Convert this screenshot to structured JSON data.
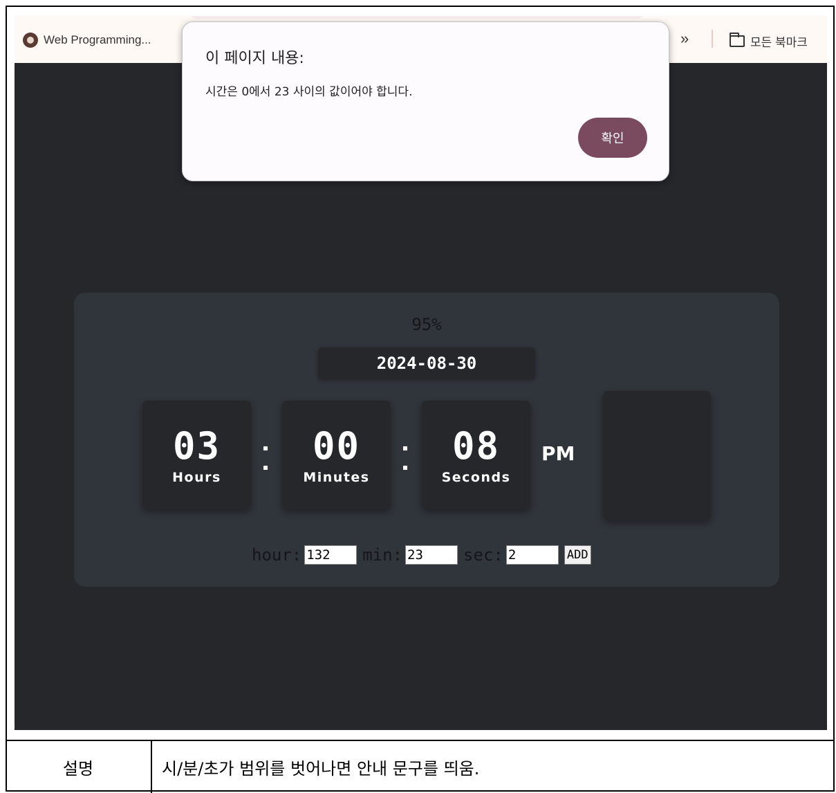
{
  "bookmarks": {
    "item1": "Web Programming...",
    "more": "»",
    "all": "모든 북마크"
  },
  "dialog": {
    "title": "이 페이지 내용:",
    "message": "시간은 0에서 23 사이의 값이어야 합니다.",
    "ok_label": "확인"
  },
  "clock": {
    "percent": "95%",
    "date": "2024-08-30",
    "hours": "03",
    "hours_label": "Hours",
    "minutes": "00",
    "minutes_label": "Minutes",
    "seconds": "08",
    "seconds_label": "Seconds",
    "ampm": "PM"
  },
  "controls": {
    "hour_label": "hour:",
    "hour_value": "132",
    "min_label": "min:",
    "min_value": "23",
    "sec_label": "sec:",
    "sec_value": "2",
    "add_label": "ADD"
  },
  "caption": {
    "label": "설명",
    "text": "시/분/초가 범위를 벗어나면 안내 문구를 띄움."
  },
  "colors": {
    "background": "#25272b",
    "card": "#30343b",
    "dialog_button": "#7a4a5e"
  },
  "icons": [
    "site-logo-icon",
    "folder-icon",
    "chevron-double-right-icon"
  ]
}
